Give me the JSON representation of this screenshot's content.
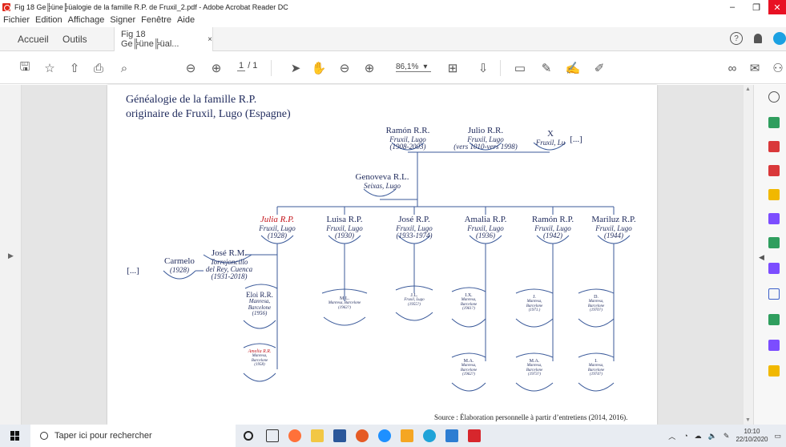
{
  "window": {
    "title": "Fig 18 Ge╠üne╠üalogie de la famille R.P. de Fruxil_2.pdf - Adobe Acrobat Reader DC",
    "controls": {
      "minimize": "–",
      "maximize": "❐",
      "close": "✕"
    }
  },
  "menu": [
    "Fichier",
    "Edition",
    "Affichage",
    "Signer",
    "Fenêtre",
    "Aide"
  ],
  "tabs": {
    "home": "Accueil",
    "tools": "Outils",
    "doc": "Fig 18 Ge╠üne╠üal...",
    "doc_close": "×"
  },
  "toolbar": {
    "page_current": "1",
    "page_total": "/ 1",
    "zoom": "86,1%"
  },
  "document": {
    "title_line1": "Généalogie de la famille R.P.",
    "title_line2": "originaire de Fruxil, Lugo (Espagne)",
    "source": "Source : Élaboration personnelle à partir d’entretiens (2014, 2016).",
    "people": {
      "ramon_sr": {
        "name": "Ramón R.R.",
        "place": "Fruxil, Lugo",
        "dates": "(1908-2003)"
      },
      "julio": {
        "name": "Julio R.R.",
        "place": "Fruxil, Lugo",
        "dates": "(vers 1010-vers 1998)"
      },
      "x": {
        "name": "X",
        "place": "Fruxil, Lu",
        "more": "[...]"
      },
      "genoveva": {
        "name": "Genoveva R.L.",
        "place": "Seixas, Lugo"
      },
      "julia": {
        "name": "Julia R.P.",
        "place": "Fruxil, Lugo",
        "dates": "(1928)"
      },
      "luisa": {
        "name": "Luisa R.P.",
        "place": "Fruxil, Lugo",
        "dates": "(1930)"
      },
      "jose_rp": {
        "name": "José R.P.",
        "place": "Fruxil, Lugo",
        "dates": "(1933-1974)"
      },
      "amalia": {
        "name": "Amalia R.P.",
        "place": "Fruxil, Lugo",
        "dates": "(1936)"
      },
      "ramon_rp": {
        "name": "Ramón R.P.",
        "place": "Fruxil, Lugo",
        "dates": "(1942)"
      },
      "mariluz": {
        "name": "Mariluz R.P.",
        "place": "Fruxil, Lugo",
        "dates": "(1944)"
      },
      "jose_rm": {
        "name": "José R.M.",
        "place": "Torrejoncillo",
        "place2": "del Rey, Cuenca",
        "dates": "(1931-2018)"
      },
      "carmelo": {
        "name": "Carmelo",
        "dates": "(1928)",
        "more": "[...]"
      },
      "eloi": {
        "name": "Eloi R.R.",
        "place": "Manresa,",
        "place2": "Barcelone",
        "dates": "(1956)"
      },
      "amelia": {
        "name": "Amelia R.R.",
        "place": "Manresa,",
        "place2": "Barcelone",
        "dates": "(1958)"
      },
      "ml": {
        "name": "M.L.",
        "place": "Manresa, Barcelone",
        "dates": "(1962?)"
      },
      "jl": {
        "name": "J.L.",
        "place": "Fruxil, Lugo",
        "dates": "(1955?)"
      },
      "ix": {
        "name": "I.X.",
        "place": "Manresa,",
        "place2": "Barcelone",
        "dates": "(1961?)"
      },
      "ma": {
        "name": "M.A.",
        "place": "Manresa,",
        "place2": "Barcelone",
        "dates": "(1962?)"
      },
      "j": {
        "name": "J.",
        "place": "Manresa,",
        "place2": "Barcelone",
        "dates": "(1971.)"
      },
      "ma2": {
        "name": "M.A.",
        "place": "Manresa,",
        "place2": "Barcelone",
        "dates": "(1973?)"
      },
      "d": {
        "name": "D.",
        "place": "Manresa,",
        "place2": "Barcelone",
        "dates": "(1970?)"
      },
      "i": {
        "name": "I.",
        "place": "Manresa,",
        "place2": "Barcelone",
        "dates": "(1974?)"
      }
    }
  },
  "taskbar": {
    "search_placeholder": "Taper ici pour rechercher",
    "time": "10:10",
    "date": "22/10/2020"
  },
  "colors": {
    "accent_red": "#e81123",
    "line": "#3b5a9a",
    "text": "#1f2a5c",
    "highlight": "#c4161c"
  }
}
